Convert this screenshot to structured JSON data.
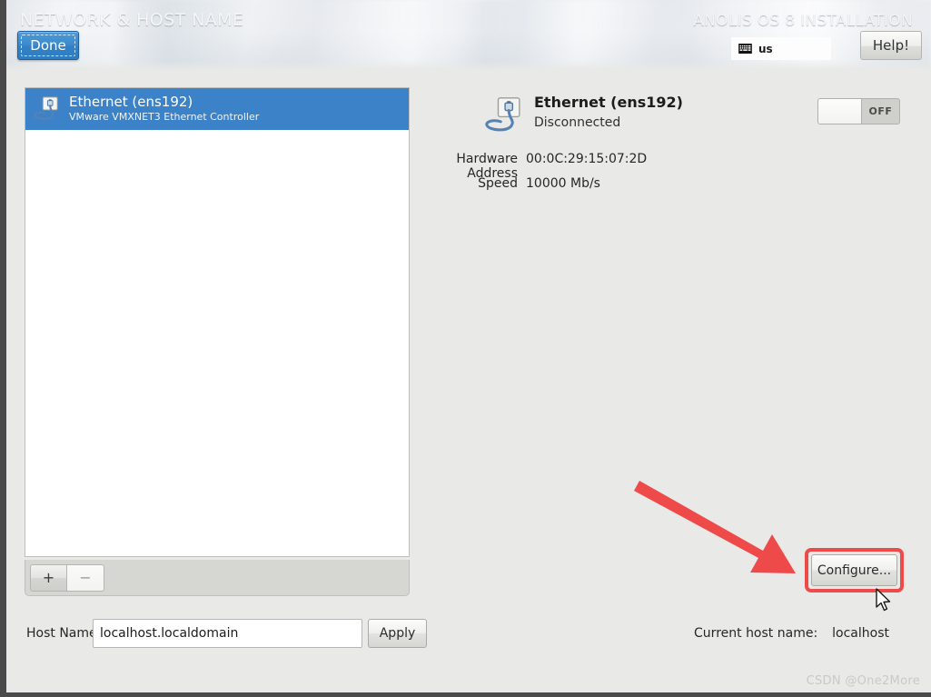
{
  "header": {
    "title": "NETWORK & HOST NAME",
    "product": "ANOLIS OS 8 INSTALLATION",
    "done_label": "Done",
    "keyboard_layout": "us",
    "keyboard_icon": "keyboard-icon",
    "help_label": "Help!"
  },
  "device_list": {
    "items": [
      {
        "name": "Ethernet (ens192)",
        "description": "VMware VMXNET3 Ethernet Controller",
        "icon": "ethernet-icon",
        "selected": true
      }
    ],
    "toolbar": {
      "add_label": "+",
      "remove_label": "−"
    }
  },
  "detail": {
    "icon": "ethernet-icon",
    "title": "Ethernet (ens192)",
    "status": "Disconnected",
    "toggle_state": "OFF",
    "properties": [
      {
        "label": "Hardware Address",
        "value": "00:0C:29:15:07:2D"
      },
      {
        "label": "Speed",
        "value": "10000 Mb/s"
      }
    ],
    "configure_label": "Configure..."
  },
  "footer": {
    "hostname_label": "Host Name:",
    "hostname_value": "localhost.localdomain",
    "hostname_placeholder": "localhost.localdomain",
    "apply_label": "Apply",
    "current_host_label": "Current host name:",
    "current_host_value": "localhost"
  },
  "annotation": {
    "arrow_color": "#ef4a4a",
    "highlight_color": "#ef4a4a",
    "watermark": "CSDN @One2More"
  },
  "colors": {
    "selection_blue": "#3c82c9",
    "done_blue": "#3d8bcd",
    "window_bg": "#e9e9e7"
  }
}
